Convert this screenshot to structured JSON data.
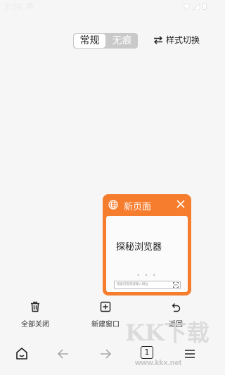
{
  "status_bar": {
    "time": "3:29",
    "notification_icon": "app-notification-icon"
  },
  "mode_switch": {
    "normal": "常规",
    "private": "无痕"
  },
  "style_switch": {
    "label": "样式切换",
    "icon": "swap-arrows-icon"
  },
  "tab_card": {
    "title": "新页面",
    "preview_heading": "探秘浏览器",
    "preview_dots": "• • •",
    "preview_search_placeholder": "搜索内容或者输入网址"
  },
  "actions": {
    "close_all": "全部关闭",
    "new_window": "新建窗口",
    "back": "返回"
  },
  "bottom_nav": {
    "tab_count": "1"
  },
  "watermark": {
    "logo": "KK下载",
    "url": "www.kkx.net"
  },
  "colors": {
    "accent": "#f77d2e",
    "background": "#f6f6f6"
  }
}
